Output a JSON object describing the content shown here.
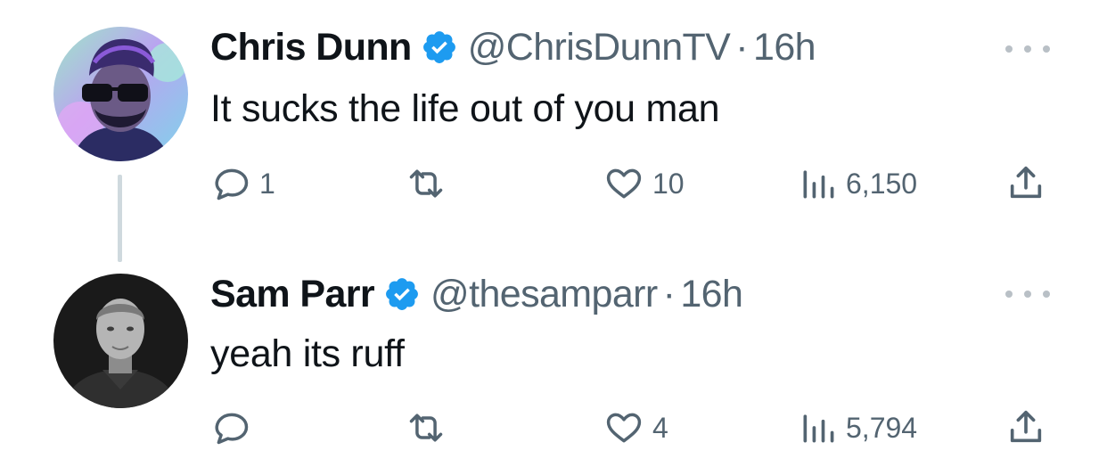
{
  "tweets": [
    {
      "display_name": "Chris Dunn",
      "handle": "@ChrisDunnTV",
      "separator": "·",
      "time": "16h",
      "text": "It sucks the life out of you man",
      "reply_count": "1",
      "repost_count": "",
      "like_count": "10",
      "view_count": "6,150",
      "verified": true
    },
    {
      "display_name": "Sam Parr",
      "handle": "@thesamparr",
      "separator": "·",
      "time": "16h",
      "text": "yeah its ruff",
      "reply_count": "",
      "repost_count": "",
      "like_count": "4",
      "view_count": "5,794",
      "verified": true
    }
  ],
  "colors": {
    "text_primary": "#0f1419",
    "text_secondary": "#536471",
    "verified_blue": "#1d9bf0",
    "thread_line": "#cfd9de"
  },
  "icons": [
    "reply-icon",
    "repost-icon",
    "like-icon",
    "views-icon",
    "share-icon",
    "more-icon",
    "verified-badge-icon"
  ]
}
